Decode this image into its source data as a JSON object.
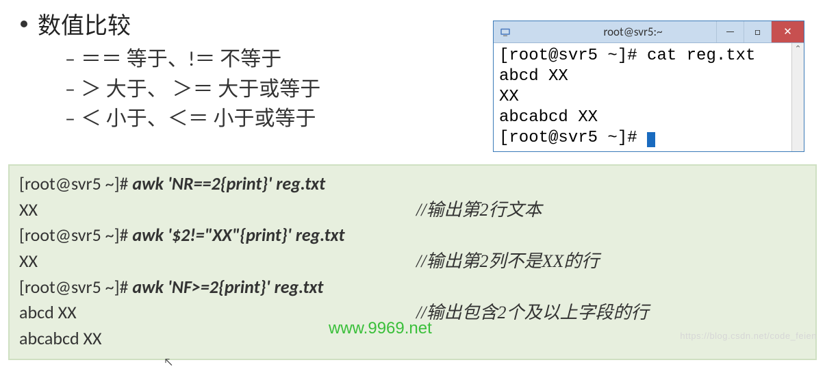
{
  "heading": "数值比较",
  "subitems": [
    "＝＝ 等于、!＝ 不等于",
    "＞ 大于、 ＞＝ 大于或等于",
    "＜ 小于、＜＝ 小于或等于"
  ],
  "terminal": {
    "title": "root@svr5:~",
    "lines": [
      "[root@svr5 ~]# cat reg.txt",
      "abcd XX",
      "XX",
      "abcabcd XX",
      "[root@svr5 ~]# "
    ],
    "win_min": "—",
    "win_max": "□",
    "win_close": "✕",
    "scroll_up": "⌃"
  },
  "codebox": {
    "rows": [
      {
        "prompt": "[root@svr5 ~]# ",
        "cmd": "awk  'NR==2{print}'  reg.txt",
        "comment": ""
      },
      {
        "output": "XX",
        "comment": "//输出第2行文本"
      },
      {
        "prompt": "[root@svr5 ~]# ",
        "cmd": "awk  '$2!=\"XX\"{print}'  reg.txt",
        "comment": ""
      },
      {
        "output": "XX",
        "comment": "//输出第2列不是XX的行"
      },
      {
        "prompt": "[root@svr5 ~]# ",
        "cmd": "awk  'NF>=2{print}'  reg.txt",
        "comment": ""
      },
      {
        "output": "abcd XX",
        "comment": "//输出包含2个及以上字段的行"
      },
      {
        "output": "abcabcd XX",
        "comment": ""
      }
    ]
  },
  "watermark1": "www.9969.net",
  "watermark2": "https://blog.csdn.net/code_feien"
}
